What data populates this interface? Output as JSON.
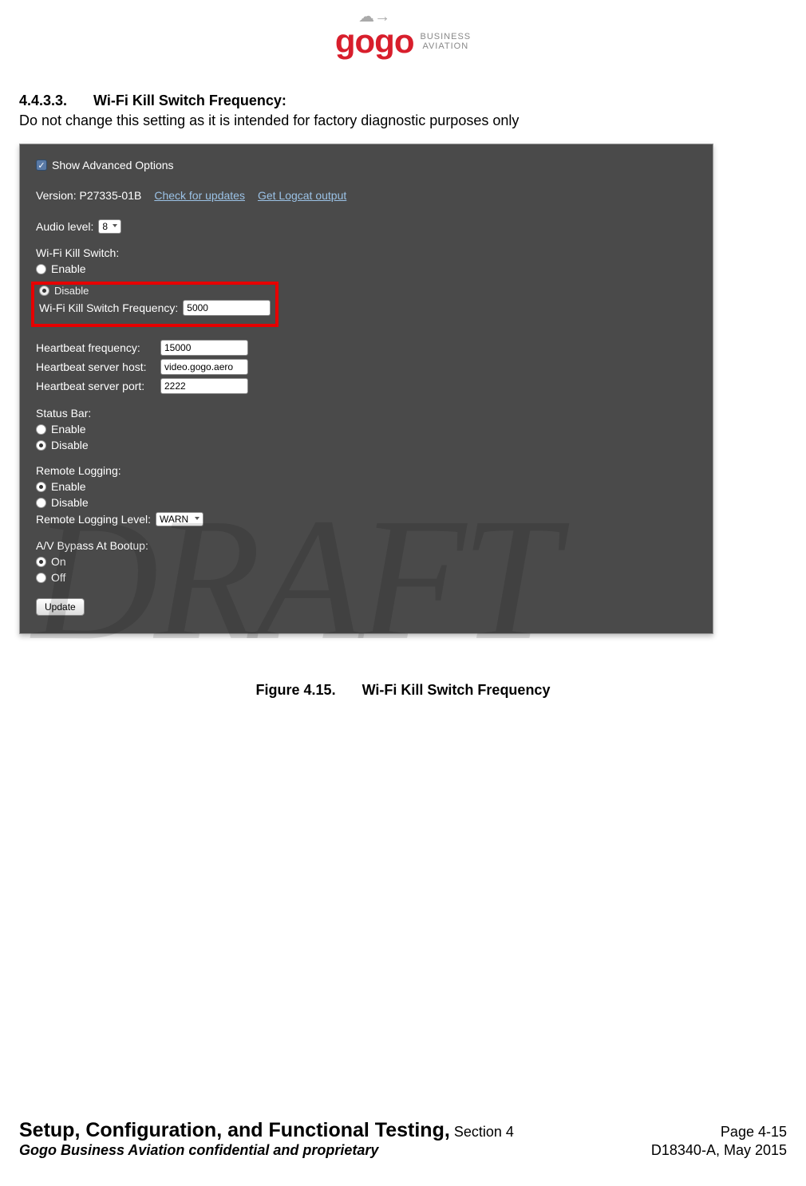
{
  "logo": {
    "brand": "gogo",
    "sub1": "BUSINESS",
    "sub2": "AVIATION"
  },
  "heading": {
    "number": "4.4.3.3.",
    "title": "Wi-Fi Kill Switch Frequency:"
  },
  "body": "Do not change this setting as it is intended for factory diagnostic purposes only",
  "ui": {
    "show_advanced": "Show Advanced Options",
    "version_label": "Version: P27335-01B",
    "check_updates": "Check for updates",
    "get_logcat": "Get Logcat output",
    "audio_level_label": "Audio level:",
    "audio_level_value": "8",
    "wifi_kill_label": "Wi-Fi Kill Switch:",
    "enable": "Enable",
    "disable": "Disable",
    "disable_cut": "Disable",
    "freq_label": "Wi-Fi Kill Switch Frequency:",
    "freq_value": "5000",
    "hb_freq_label": "Heartbeat frequency:",
    "hb_freq_value": "15000",
    "hb_host_label": "Heartbeat server host:",
    "hb_host_value": "video.gogo.aero",
    "hb_port_label": "Heartbeat server port:",
    "hb_port_value": "2222",
    "status_bar_label": "Status Bar:",
    "remote_log_label": "Remote Logging:",
    "remote_log_level_label": "Remote Logging Level:",
    "remote_log_level_value": "WARN",
    "bypass_label": "A/V Bypass At Bootup:",
    "on": "On",
    "off": "Off",
    "update_btn": "Update"
  },
  "figure": {
    "number": "Figure 4.15.",
    "caption": "Wi-Fi Kill Switch Frequency"
  },
  "watermark": "DRAFT",
  "footer": {
    "title": "Setup, Configuration, and Functional Testing,",
    "section": "Section 4",
    "page": "Page 4-15",
    "confidential": "Gogo Business Aviation confidential and proprietary",
    "docnum": "D18340-A, May 2015"
  }
}
